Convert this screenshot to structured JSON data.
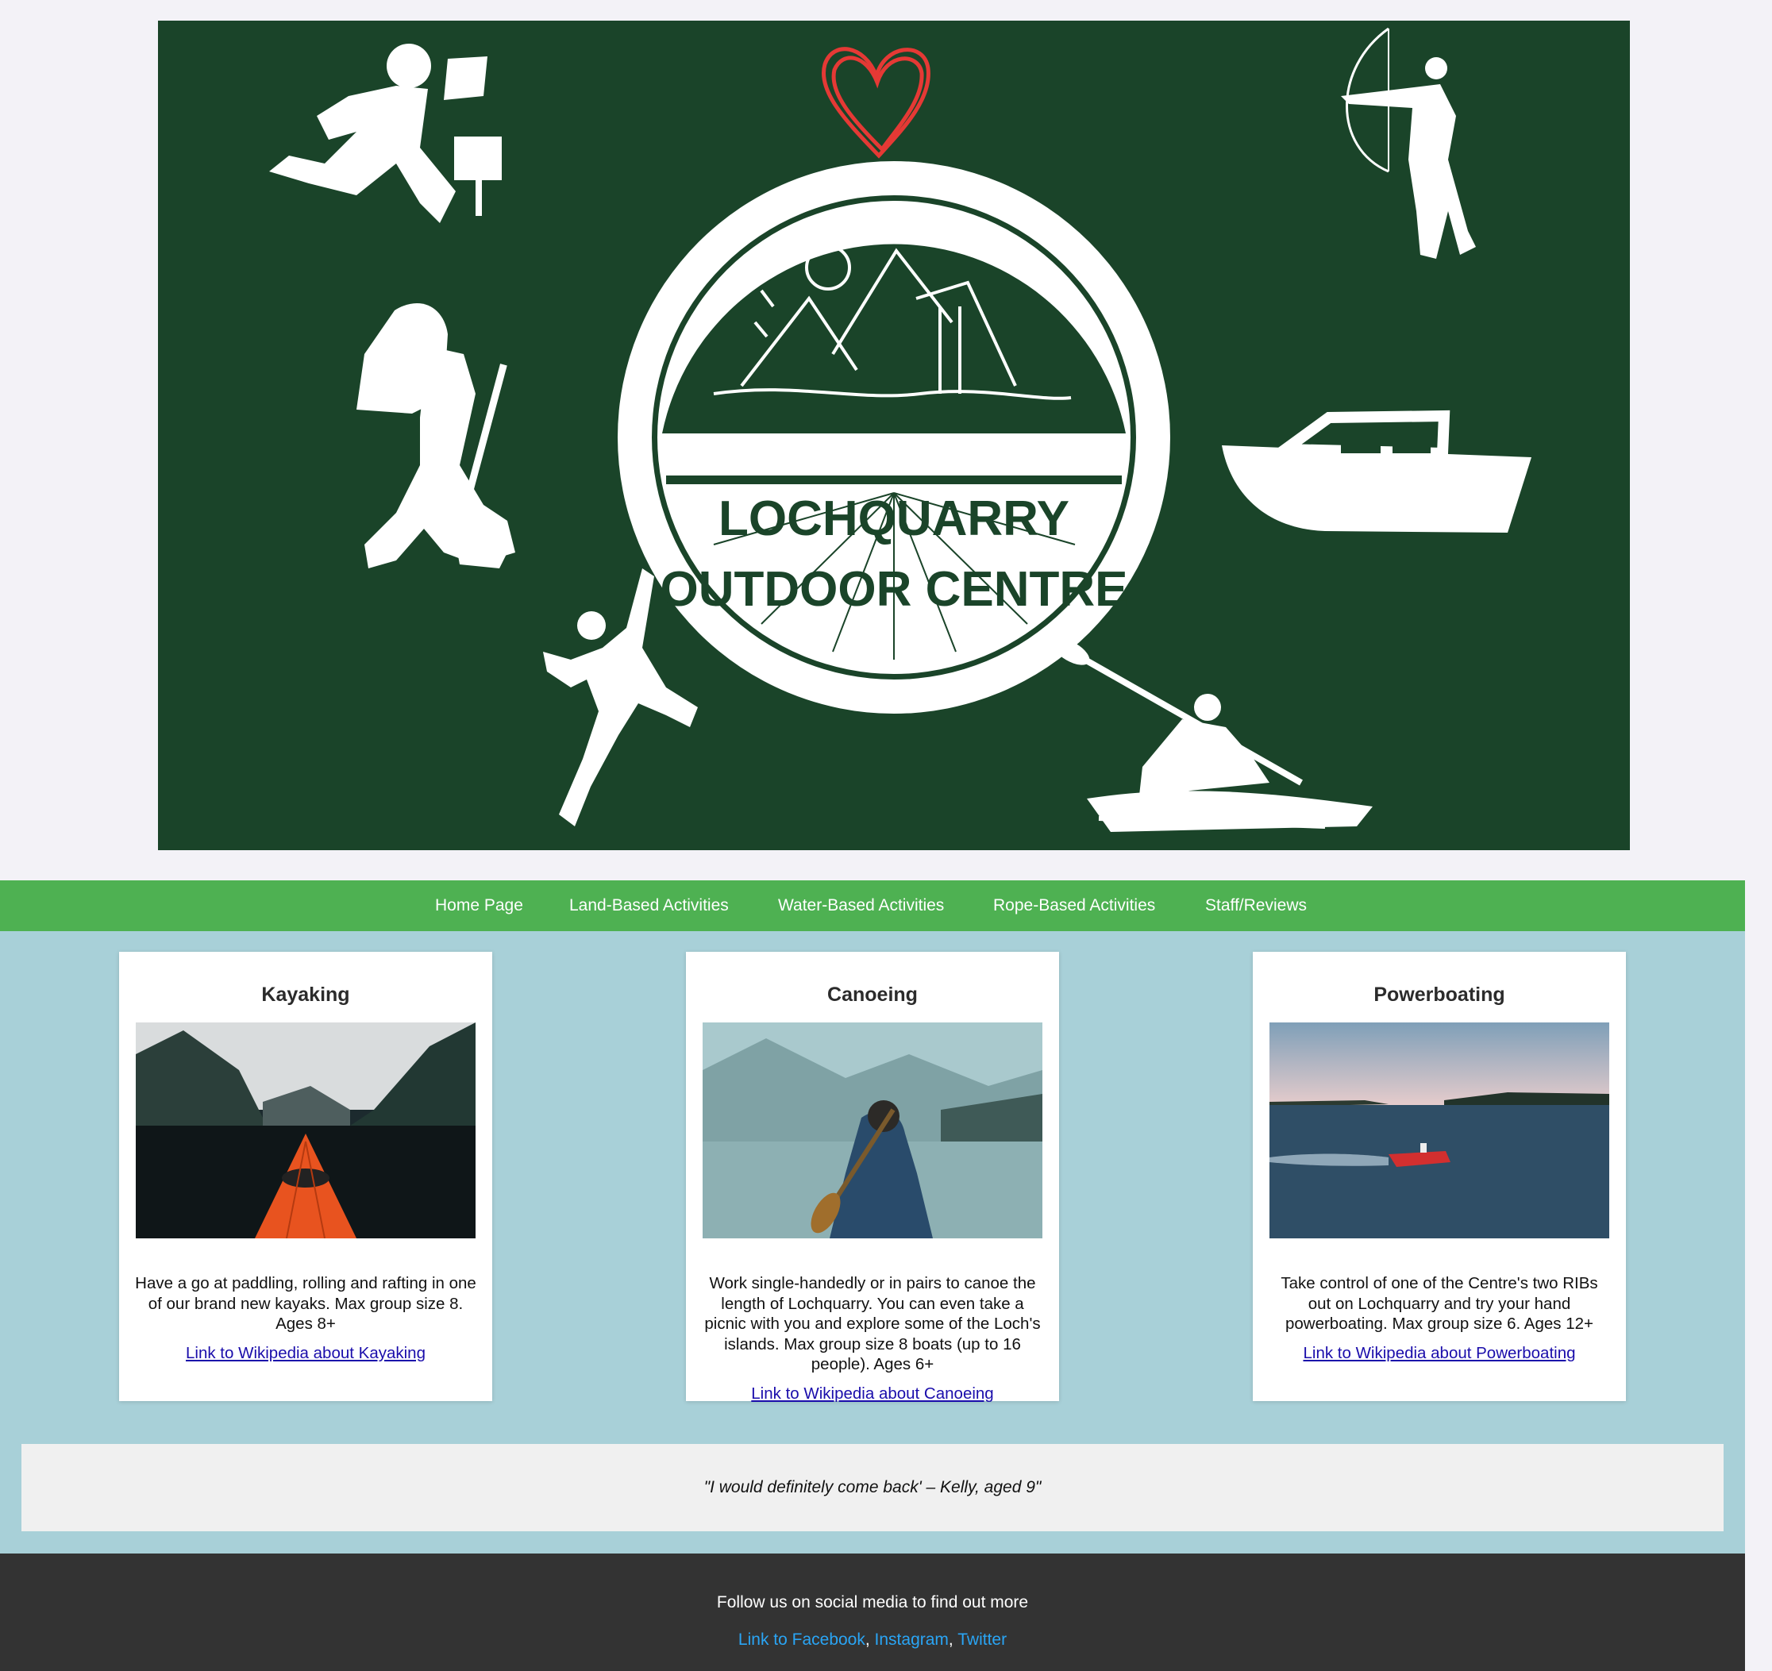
{
  "banner": {
    "logo_line1": "LOCHQUARRY",
    "logo_line2": "OUTDOOR CENTRE",
    "background_color": "#1a4429",
    "icons": [
      "orienteering-runner-icon",
      "archer-icon",
      "hiker-icon",
      "powerboat-icon",
      "climber-icon",
      "kayaker-icon",
      "heart-icon"
    ]
  },
  "nav": {
    "items": [
      {
        "label": "Home Page"
      },
      {
        "label": "Land-Based Activities"
      },
      {
        "label": "Water-Based Activities"
      },
      {
        "label": "Rope-Based Activities"
      },
      {
        "label": "Staff/Reviews"
      }
    ],
    "background_color": "#4eb152"
  },
  "activities": [
    {
      "title": "Kayaking",
      "description": "Have a go at paddling, rolling and rafting in one of our brand new kayaks. Max group size 8. Ages 8+",
      "link": "Link to Wikipedia about Kayaking"
    },
    {
      "title": "Canoeing",
      "description": "Work single-handedly or in pairs to canoe the length of Lochquarry. You can even take a picnic with you and explore some of the Loch's islands. Max group size 8 boats (up to 16 people). Ages 6+",
      "link": "Link to Wikipedia about Canoeing"
    },
    {
      "title": "Powerboating",
      "description": "Take control of one of the Centre's two RIBs out on Lochquarry and try your hand powerboating. Max group size 6. Ages 12+",
      "link": "Link to Wikipedia about Powerboating"
    }
  ],
  "review": {
    "quote": "\"I would definitely come back' – Kelly, aged 9\""
  },
  "footer": {
    "text": "Follow us on social media to find out more",
    "links": {
      "facebook": "Link to Facebook",
      "instagram": "Instagram",
      "twitter": "Twitter"
    },
    "separator": ","
  }
}
